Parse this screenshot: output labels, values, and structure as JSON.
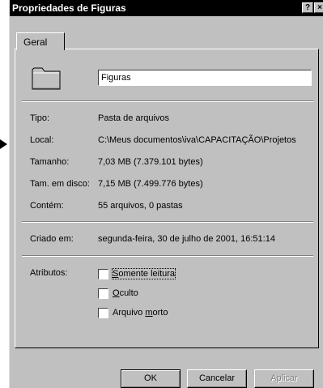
{
  "window": {
    "title": "Propriedades de Figuras",
    "help_glyph": "?",
    "close_glyph": "×"
  },
  "tabs": [
    {
      "label": "Geral",
      "active": true
    }
  ],
  "general": {
    "icon": "folder-icon",
    "name_value": "Figuras",
    "rows1": [
      {
        "label": "Tipo:",
        "value": "Pasta de arquivos"
      },
      {
        "label": "Local:",
        "value": "C:\\Meus documentos\\iva\\CAPACITAÇÃO\\Projetos"
      },
      {
        "label": "Tamanho:",
        "value": "7,03 MB (7.379.101 bytes)"
      },
      {
        "label": "Tam. em disco:",
        "value": "7,15 MB (7.499.776 bytes)"
      },
      {
        "label": "Contém:",
        "value": "55 arquivos, 0 pastas"
      }
    ],
    "created": {
      "label": "Criado em:",
      "value": "segunda-feira, 30 de julho de 2001, 16:51:14"
    },
    "attributes": {
      "label": "Atributos:",
      "items": [
        {
          "pre": "",
          "key": "S",
          "post": "omente leitura",
          "checked": false
        },
        {
          "pre": "",
          "key": "O",
          "post": "culto",
          "checked": false
        },
        {
          "pre": "Arquivo ",
          "key": "m",
          "post": "orto",
          "checked": false
        }
      ]
    }
  },
  "buttons": {
    "ok": "OK",
    "cancel": "Cancelar",
    "apply": "Aplicar"
  }
}
